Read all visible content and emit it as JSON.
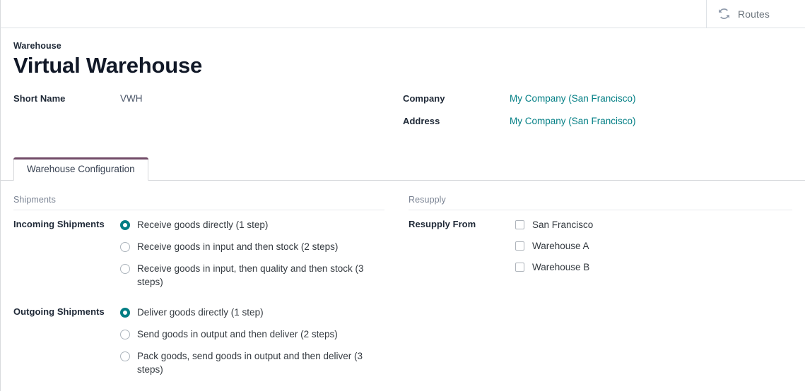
{
  "control_panel": {
    "smart_buttons": [
      {
        "icon": "refresh-cycle-icon",
        "label": "Routes"
      }
    ]
  },
  "record": {
    "model_label": "Warehouse",
    "title": "Virtual Warehouse"
  },
  "fields": {
    "left": [
      {
        "label": "Short Name",
        "value": "VWH",
        "is_link": false
      }
    ],
    "right": [
      {
        "label": "Company",
        "value": "My Company (San Francisco)",
        "is_link": true
      },
      {
        "label": "Address",
        "value": "My Company (San Francisco)",
        "is_link": true
      }
    ]
  },
  "notebook": {
    "tabs": [
      {
        "label": "Warehouse Configuration",
        "active": true
      }
    ]
  },
  "tab_page": {
    "left": {
      "group_title": "Shipments",
      "radio_fields": [
        {
          "label": "Incoming Shipments",
          "options": [
            {
              "text": "Receive goods directly (1 step)",
              "checked": true
            },
            {
              "text": "Receive goods in input and then stock (2 steps)",
              "checked": false
            },
            {
              "text": "Receive goods in input, then quality and then stock (3 steps)",
              "checked": false
            }
          ]
        },
        {
          "label": "Outgoing Shipments",
          "options": [
            {
              "text": "Deliver goods directly (1 step)",
              "checked": true
            },
            {
              "text": "Send goods in output and then deliver (2 steps)",
              "checked": false
            },
            {
              "text": "Pack goods, send goods in output and then deliver (3 steps)",
              "checked": false
            }
          ]
        }
      ]
    },
    "right": {
      "group_title": "Resupply",
      "checkbox_field": {
        "label": "Resupply From",
        "options": [
          {
            "text": "San Francisco",
            "checked": false
          },
          {
            "text": "Warehouse A",
            "checked": false
          },
          {
            "text": "Warehouse B",
            "checked": false
          }
        ]
      }
    }
  },
  "colors": {
    "accent_teal": "#017e84",
    "brand_purple": "#714B67",
    "muted_gray": "#7b8494"
  }
}
